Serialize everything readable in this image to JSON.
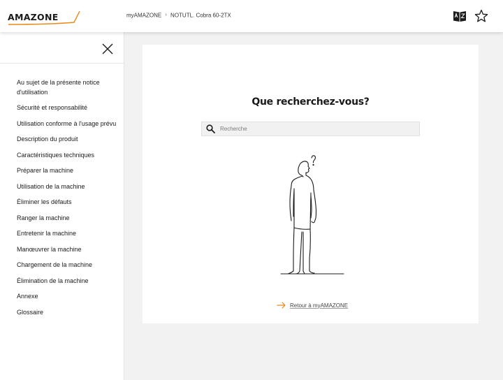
{
  "header": {
    "logo_text": "AMAZONE",
    "breadcrumb": {
      "root": "myAMAZONE",
      "separator": "›",
      "current": "NOTUTL. Cobra 60-2TX"
    },
    "icons": {
      "dictionary": "dictionary-icon",
      "favorite": "star-icon"
    }
  },
  "sidebar": {
    "close_icon": "close-icon",
    "items": [
      {
        "label": "Au sujet de la présente notice d'utilisation"
      },
      {
        "label": "Sécurité et responsabilité"
      },
      {
        "label": "Utilisation conforme à l'usage prévu"
      },
      {
        "label": "Description du produit"
      },
      {
        "label": "Caractéristiques techniques"
      },
      {
        "label": "Préparer la machine"
      },
      {
        "label": "Utilisation de la machine"
      },
      {
        "label": "Éliminer les défauts"
      },
      {
        "label": "Ranger la machine"
      },
      {
        "label": "Entretenir la machine"
      },
      {
        "label": "Manœuvrer la machine"
      },
      {
        "label": "Chargement de la machine"
      },
      {
        "label": "Élimination de la machine"
      },
      {
        "label": "Annexe"
      },
      {
        "label": "Glossaire"
      }
    ]
  },
  "main": {
    "title": "Que recherchez-vous?",
    "search": {
      "placeholder": "Recherche",
      "value": "",
      "icon": "search-icon"
    },
    "illustration": "person-thinking-illustration",
    "back_link": {
      "label": "Retour à myAMAZONE",
      "icon": "arrow-right-icon"
    }
  },
  "colors": {
    "brand_accent": "#e8891c",
    "background": "#f2f2f2",
    "card": "#ffffff",
    "text": "#1a1a1a"
  }
}
